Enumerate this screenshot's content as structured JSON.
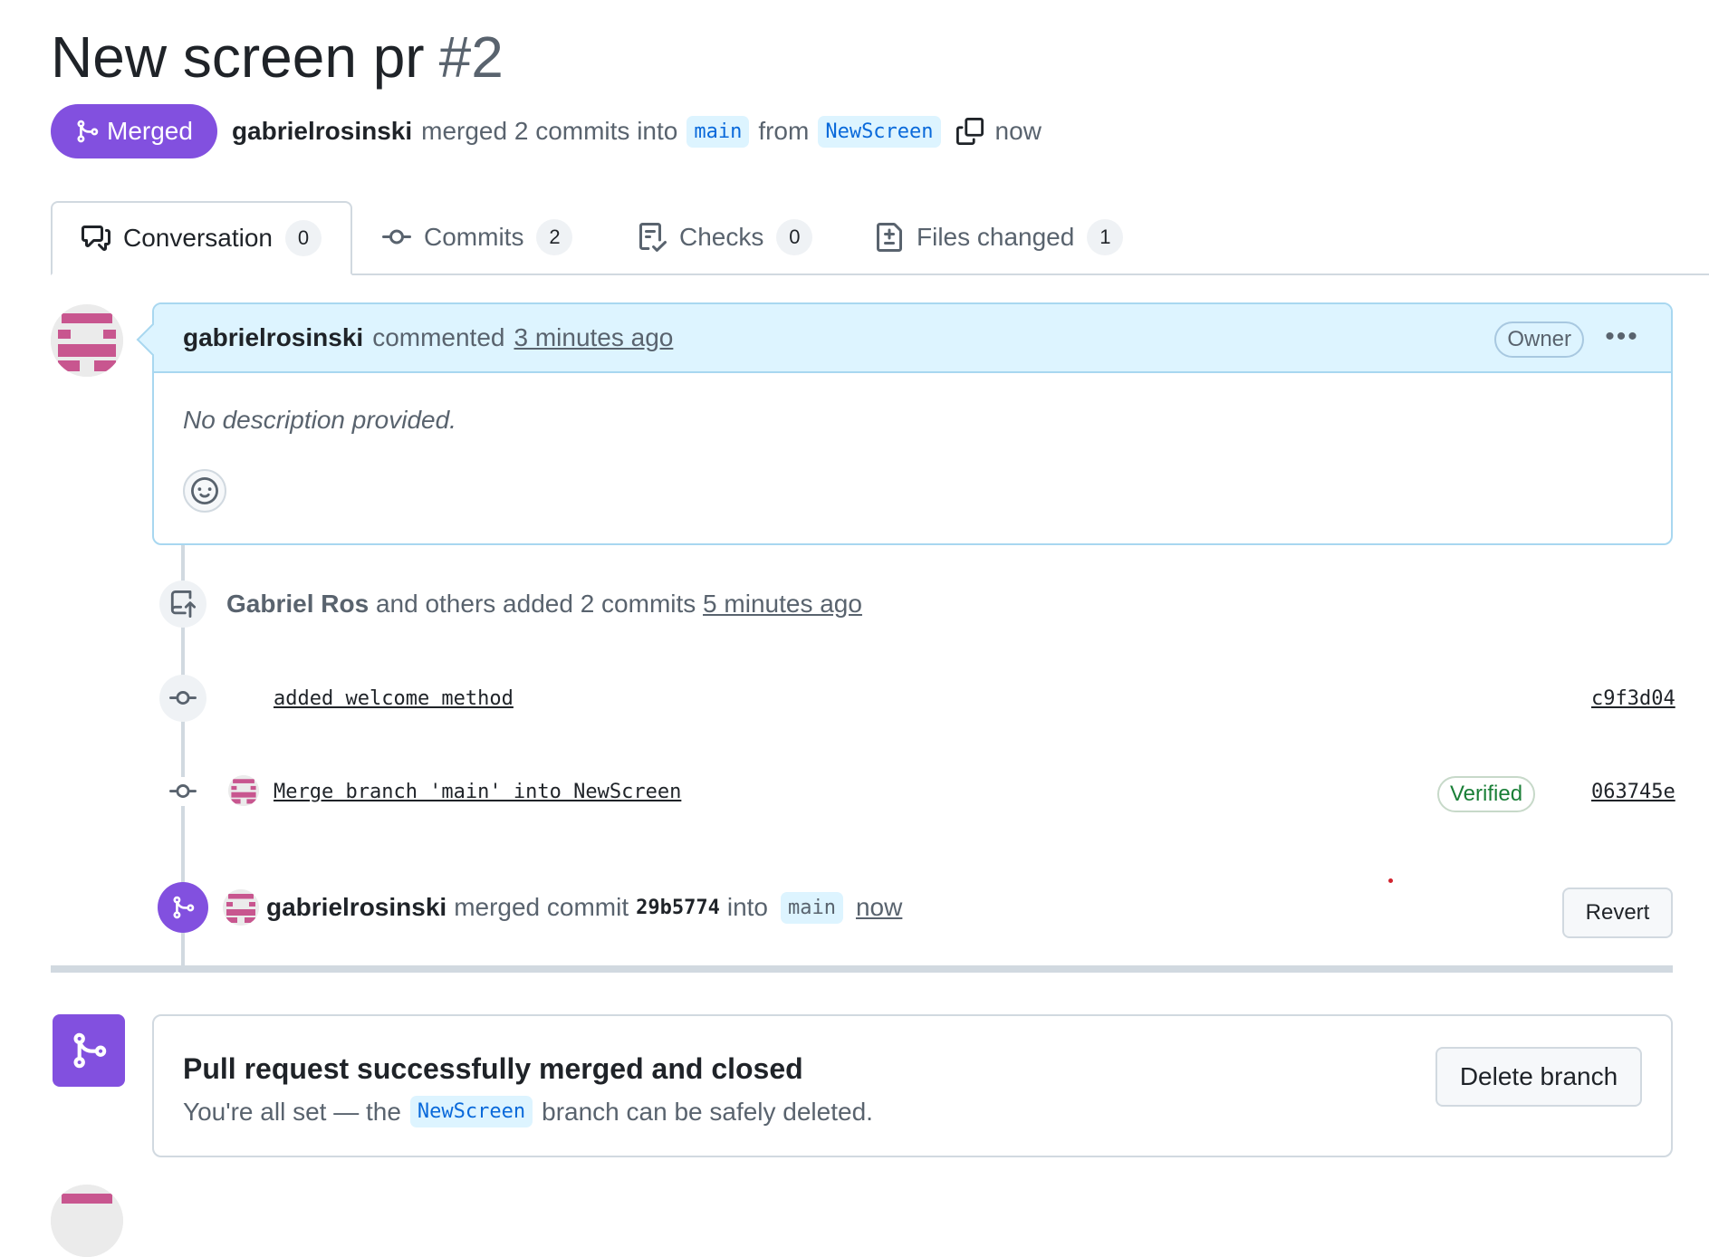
{
  "pr": {
    "title": "New screen pr",
    "number": "#2",
    "state": "Merged",
    "author": "gabrielrosinski",
    "summary_mid": "merged 2 commits into",
    "base_branch": "main",
    "from_word": "from",
    "head_branch": "NewScreen",
    "time": "now"
  },
  "tabs": [
    {
      "label": "Conversation",
      "count": "0",
      "icon": "comment-discussion-icon"
    },
    {
      "label": "Commits",
      "count": "2",
      "icon": "git-commit-icon"
    },
    {
      "label": "Checks",
      "count": "0",
      "icon": "checklist-icon"
    },
    {
      "label": "Files changed",
      "count": "1",
      "icon": "file-diff-icon"
    }
  ],
  "comment": {
    "author": "gabrielrosinski",
    "action": "commented",
    "time": "3 minutes ago",
    "badge": "Owner",
    "menu": "•••",
    "body": "No description provided."
  },
  "commits_event": {
    "author": "Gabriel Ros",
    "text": "and others added 2 commits",
    "time": "5 minutes ago"
  },
  "commits": [
    {
      "message": "added welcome method",
      "sha": "c9f3d04",
      "verified": ""
    },
    {
      "message": "Merge branch 'main' into NewScreen",
      "sha": "063745e",
      "verified": "Verified"
    }
  ],
  "merge_event": {
    "author": "gabrielrosinski",
    "text": "merged commit",
    "commit": "29b5774",
    "into": "into",
    "branch": "main",
    "time": "now",
    "revert_label": "Revert"
  },
  "status": {
    "title": "Pull request successfully merged and closed",
    "sub_before": "You're all set — the",
    "branch": "NewScreen",
    "sub_after": "branch can be safely deleted.",
    "delete_label": "Delete branch"
  },
  "colors": {
    "merged_purple": "#8250df",
    "branch_chip_bg": "#ddf4ff",
    "verified_green": "#1a7f37",
    "avatar_pink": "#c8568f"
  }
}
